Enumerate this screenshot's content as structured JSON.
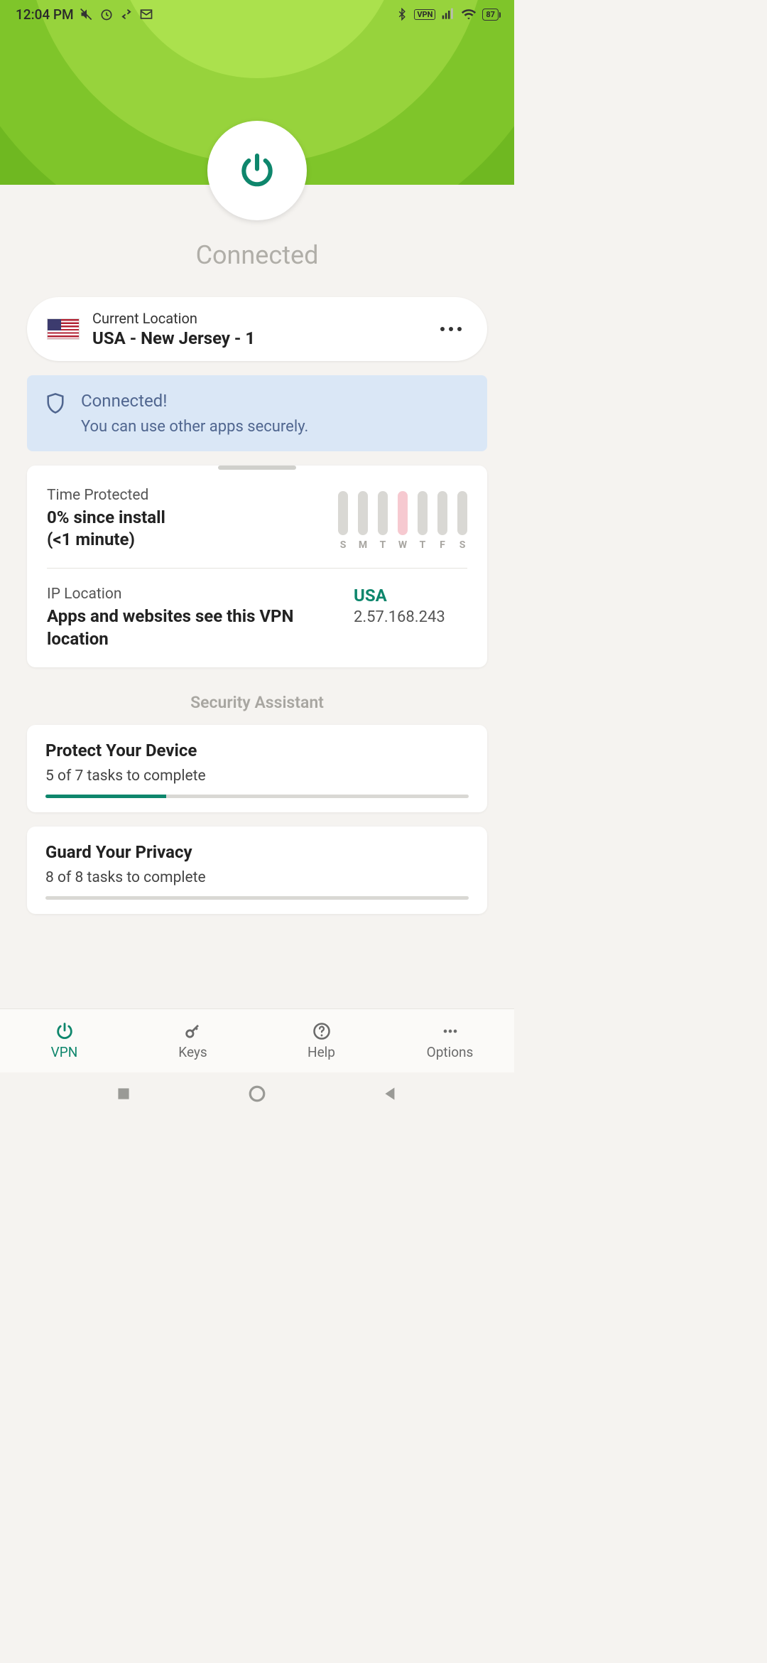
{
  "status_bar": {
    "time": "12:04 PM",
    "battery": "87",
    "vpn_badge": "VPN"
  },
  "connected_label": "Connected",
  "location": {
    "label": "Current Location",
    "value": "USA - New Jersey - 1"
  },
  "banner": {
    "title": "Connected!",
    "subtitle": "You can use other apps securely."
  },
  "time_protected": {
    "label": "Time Protected",
    "value": "0% since install",
    "sub": "(<1 minute)",
    "days": [
      "S",
      "M",
      "T",
      "W",
      "T",
      "F",
      "S"
    ],
    "highlight_index": 3
  },
  "ip_location": {
    "label": "IP Location",
    "desc": "Apps and websites see this VPN location",
    "country": "USA",
    "ip": "2.57.168.243"
  },
  "security_header": "Security Assistant",
  "tasks": [
    {
      "title": "Protect Your Device",
      "sub": "5 of 7 tasks to complete",
      "done": 5,
      "total": 7
    },
    {
      "title": "Guard Your Privacy",
      "sub": "8 of 8 tasks to complete",
      "done": 8,
      "total": 8
    }
  ],
  "tabs": [
    {
      "label": "VPN",
      "icon": "power"
    },
    {
      "label": "Keys",
      "icon": "key"
    },
    {
      "label": "Help",
      "icon": "help"
    },
    {
      "label": "Options",
      "icon": "dots"
    }
  ]
}
